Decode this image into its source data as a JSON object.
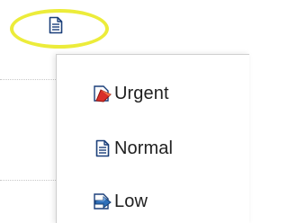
{
  "trigger": {
    "icon": "document-icon"
  },
  "menu": {
    "items": [
      {
        "label": "Urgent",
        "icon": "urgent-priority-icon"
      },
      {
        "label": "Normal",
        "icon": "document-icon"
      },
      {
        "label": "Low",
        "icon": "low-priority-icon"
      }
    ]
  },
  "colors": {
    "highlight": "#ecec3a",
    "urgent_red": "#d9302a",
    "low_blue": "#2f6fb8",
    "text": "#1f1f1f"
  }
}
